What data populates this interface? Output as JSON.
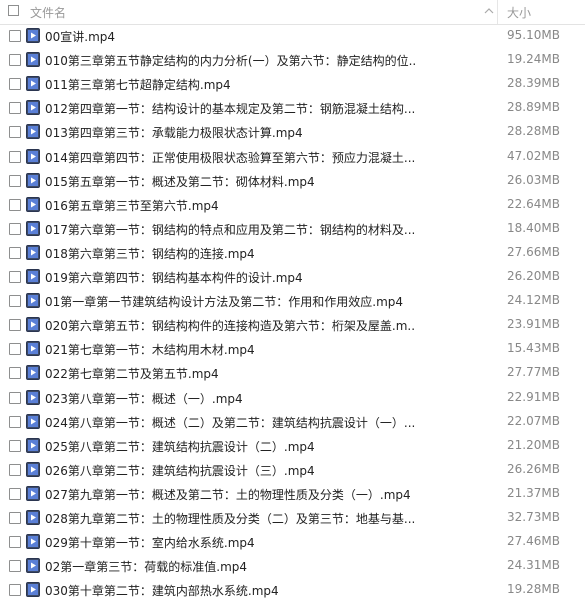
{
  "header": {
    "name_label": "文件名",
    "size_label": "大小",
    "sort_icon": "chevron-up-icon"
  },
  "file_icon": "video-file-icon",
  "colors": {
    "header_text": "#999999",
    "file_name": "#222222",
    "file_size": "#888888",
    "icon_blue": "#5a7fd6"
  },
  "files": [
    {
      "name": "00宣讲.mp4",
      "size": "95.10MB"
    },
    {
      "name": "010第三章第五节静定结构的内力分析(一）及第六节：静定结构的位...",
      "size": "19.24MB"
    },
    {
      "name": "011第三章第七节超静定结构.mp4",
      "size": "28.39MB"
    },
    {
      "name": "012第四章第一节：结构设计的基本规定及第二节：钢筋混凝土结构...",
      "size": "28.89MB"
    },
    {
      "name": "013第四章第三节：承载能力极限状态计算.mp4",
      "size": "28.28MB"
    },
    {
      "name": "014第四章第四节：正常使用极限状态验算至第六节：预应力混凝土...",
      "size": "47.02MB"
    },
    {
      "name": "015第五章第一节：概述及第二节：砌体材料.mp4",
      "size": "26.03MB"
    },
    {
      "name": "016第五章第三节至第六节.mp4",
      "size": "22.64MB"
    },
    {
      "name": "017第六章第一节：钢结构的特点和应用及第二节：钢结构的材料及...",
      "size": "18.40MB"
    },
    {
      "name": "018第六章第三节：钢结构的连接.mp4",
      "size": "27.66MB"
    },
    {
      "name": "019第六章第四节：钢结构基本构件的设计.mp4",
      "size": "26.20MB"
    },
    {
      "name": "01第一章第一节建筑结构设计方法及第二节：作用和作用效应.mp4",
      "size": "24.12MB"
    },
    {
      "name": "020第六章第五节：钢结构构件的连接构造及第六节：桁架及屋盖.m...",
      "size": "23.91MB"
    },
    {
      "name": "021第七章第一节：木结构用木材.mp4",
      "size": "15.43MB"
    },
    {
      "name": "022第七章第二节及第五节.mp4",
      "size": "27.77MB"
    },
    {
      "name": "023第八章第一节：概述（一）.mp4",
      "size": "22.91MB"
    },
    {
      "name": "024第八章第一节：概述（二）及第二节：建筑结构抗震设计（一）...",
      "size": "22.07MB"
    },
    {
      "name": "025第八章第二节：建筑结构抗震设计（二）.mp4",
      "size": "21.20MB"
    },
    {
      "name": "026第八章第二节：建筑结构抗震设计（三）.mp4",
      "size": "26.26MB"
    },
    {
      "name": "027第九章第一节：概述及第二节：土的物理性质及分类（一）.mp4",
      "size": "21.37MB"
    },
    {
      "name": "028第九章第二节：土的物理性质及分类（二）及第三节：地基与基...",
      "size": "32.73MB"
    },
    {
      "name": "029第十章第一节：室内给水系统.mp4",
      "size": "27.46MB"
    },
    {
      "name": "02第一章第三节：荷载的标准值.mp4",
      "size": "24.31MB"
    },
    {
      "name": "030第十章第二节：建筑内部热水系统.mp4",
      "size": "19.28MB"
    }
  ]
}
